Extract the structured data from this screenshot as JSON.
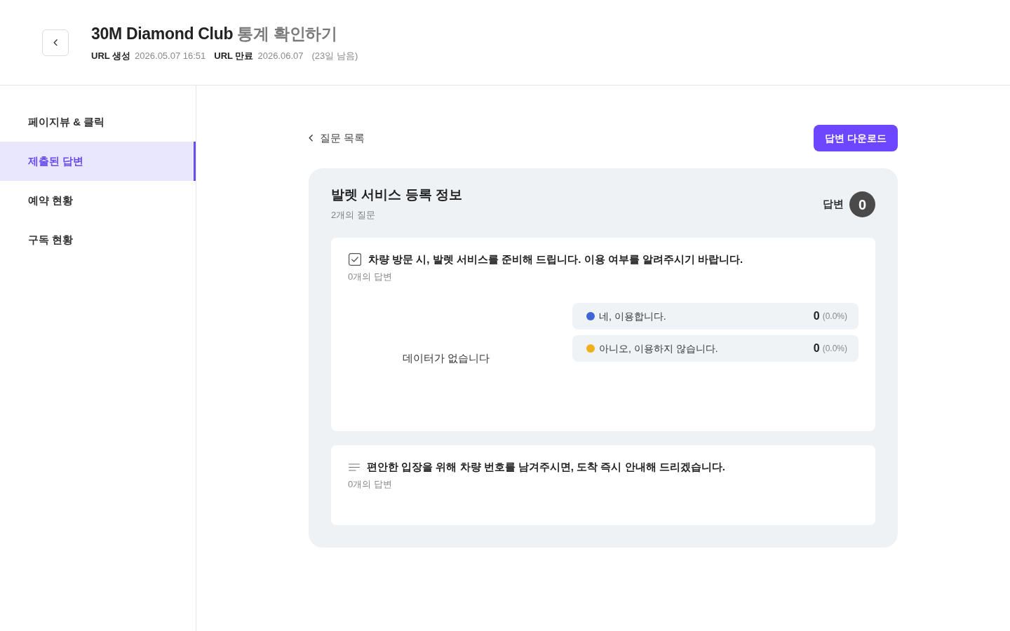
{
  "header": {
    "title": "30M Diamond Club",
    "title_suffix": "통계 확인하기",
    "meta": [
      {
        "label": "URL 생성",
        "value": "2026.05.07 16:51"
      },
      {
        "label": "URL 만료",
        "value": "2026.06.07",
        "note": "(23일 남음)"
      }
    ]
  },
  "sidebar": {
    "items": [
      {
        "label": "페이지뷰 & 클릭",
        "selected": false
      },
      {
        "label": "제출된 답변",
        "selected": true
      },
      {
        "label": "예약 현황",
        "selected": false
      },
      {
        "label": "구독 현황",
        "selected": false
      }
    ]
  },
  "toolbar": {
    "back_link": "질문 목록",
    "download_button": "답변 다운로드"
  },
  "section": {
    "title": "발렛 서비스 등록 정보",
    "subtitle": "2개의 질문",
    "answer_label": "답변",
    "answer_count": "0",
    "questions": [
      {
        "kind": "choice",
        "title": "차량 방문 시, 발렛 서비스를 준비해 드립니다. 이용 여부를 알려주시기 바랍니다.",
        "answer_count": "0개의 답변",
        "empty_text": "데이터가 없습니다",
        "options": [
          {
            "label": "네, 이용합니다.",
            "color": "#3f64d6",
            "count": "0",
            "percent": "(0.0%)"
          },
          {
            "label": "아니오, 이용하지 않습니다.",
            "color": "#f0b01e",
            "count": "0",
            "percent": "(0.0%)"
          }
        ]
      },
      {
        "kind": "text",
        "title": "편안한 입장을 위해 차량 번호를 남겨주시면, 도착 즉시 안내해 드리겠습니다.",
        "answer_count": "0개의 답변"
      }
    ]
  }
}
